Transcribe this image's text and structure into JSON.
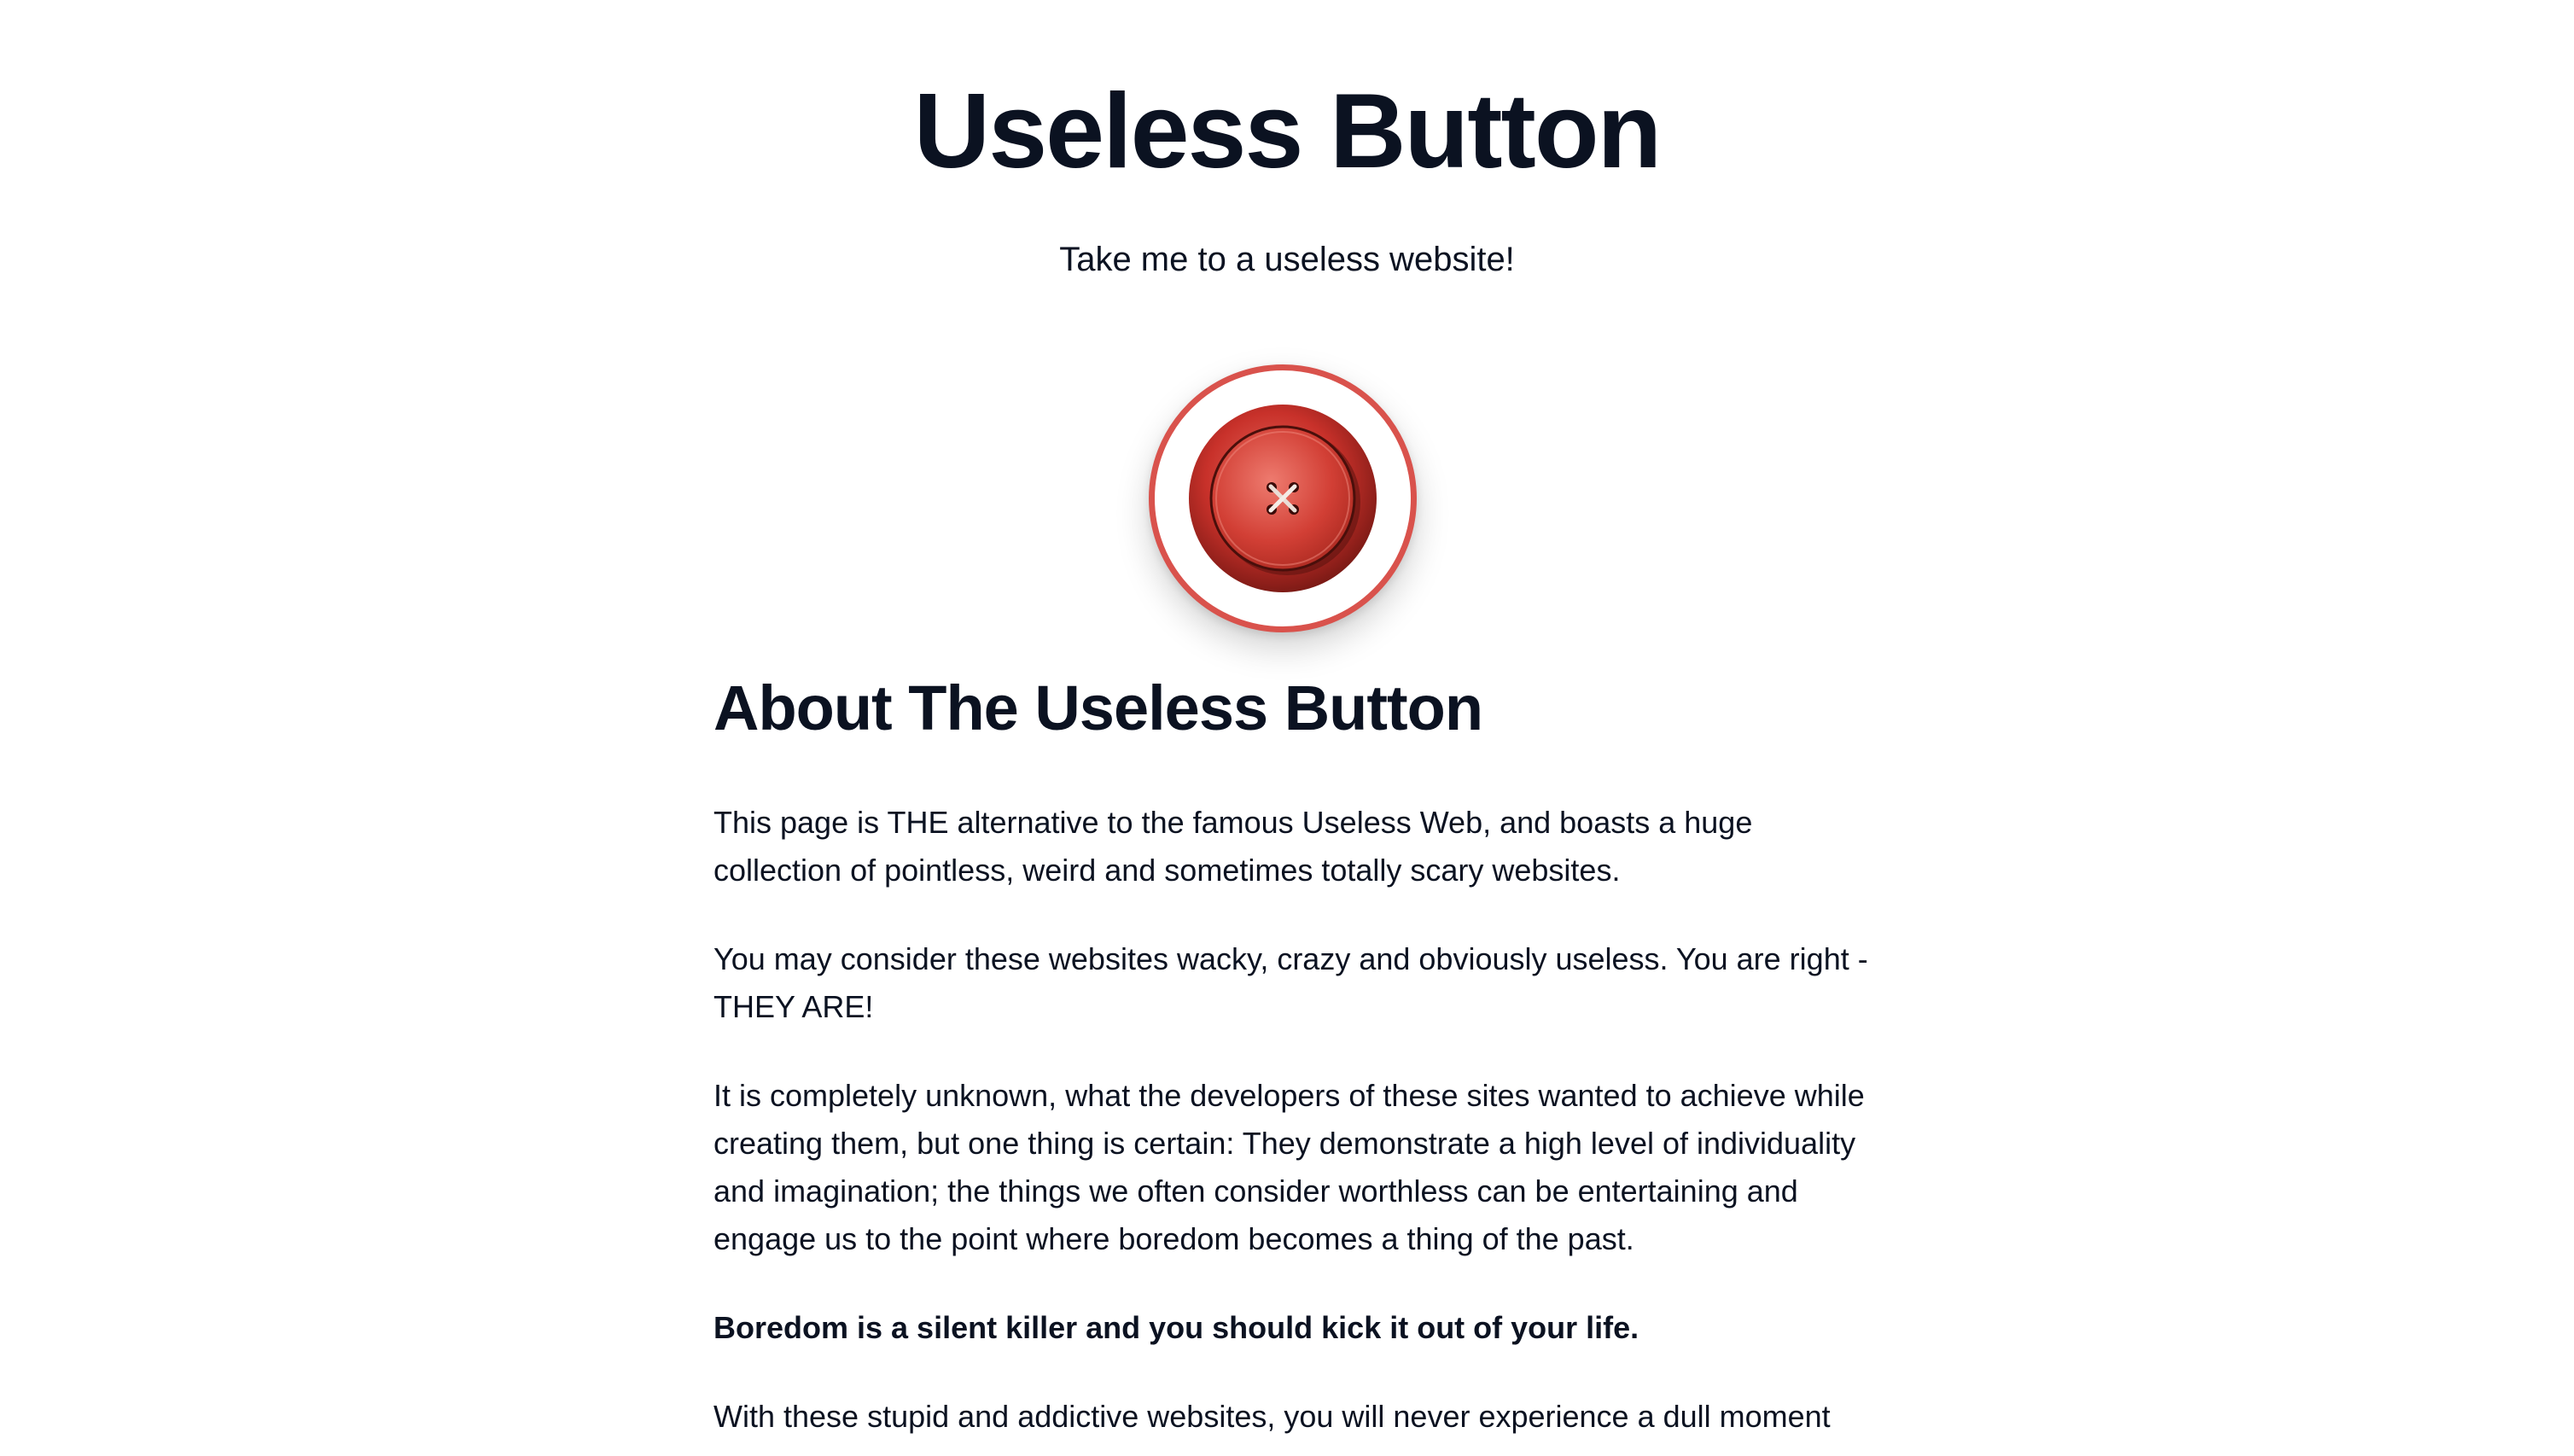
{
  "header": {
    "title": "Useless Button",
    "tagline": "Take me to a useless website!"
  },
  "colors": {
    "ring": "#d9524c",
    "button": "#c8312a",
    "text": "#0b1221"
  },
  "useless_button": {
    "icon": "red-sewing-button-icon"
  },
  "about": {
    "heading": "About The Useless Button",
    "paragraphs": [
      "This page is THE alternative to the famous Useless Web, and boasts a huge collection of pointless, weird and sometimes totally scary websites.",
      "You may consider these websites wacky, crazy and obviously useless. You are right - THEY ARE!",
      "It is completely unknown, what the developers of these sites wanted to achieve while creating them, but one thing is certain: They demonstrate a high level of individuality and imagination; the things we often consider worthless can be entertaining and engage us to the point where boredom becomes a thing of the past.",
      "Boredom is a silent killer and you should kick it out of your life.",
      "With these stupid and addictive websites, you will never experience a dull moment"
    ]
  }
}
